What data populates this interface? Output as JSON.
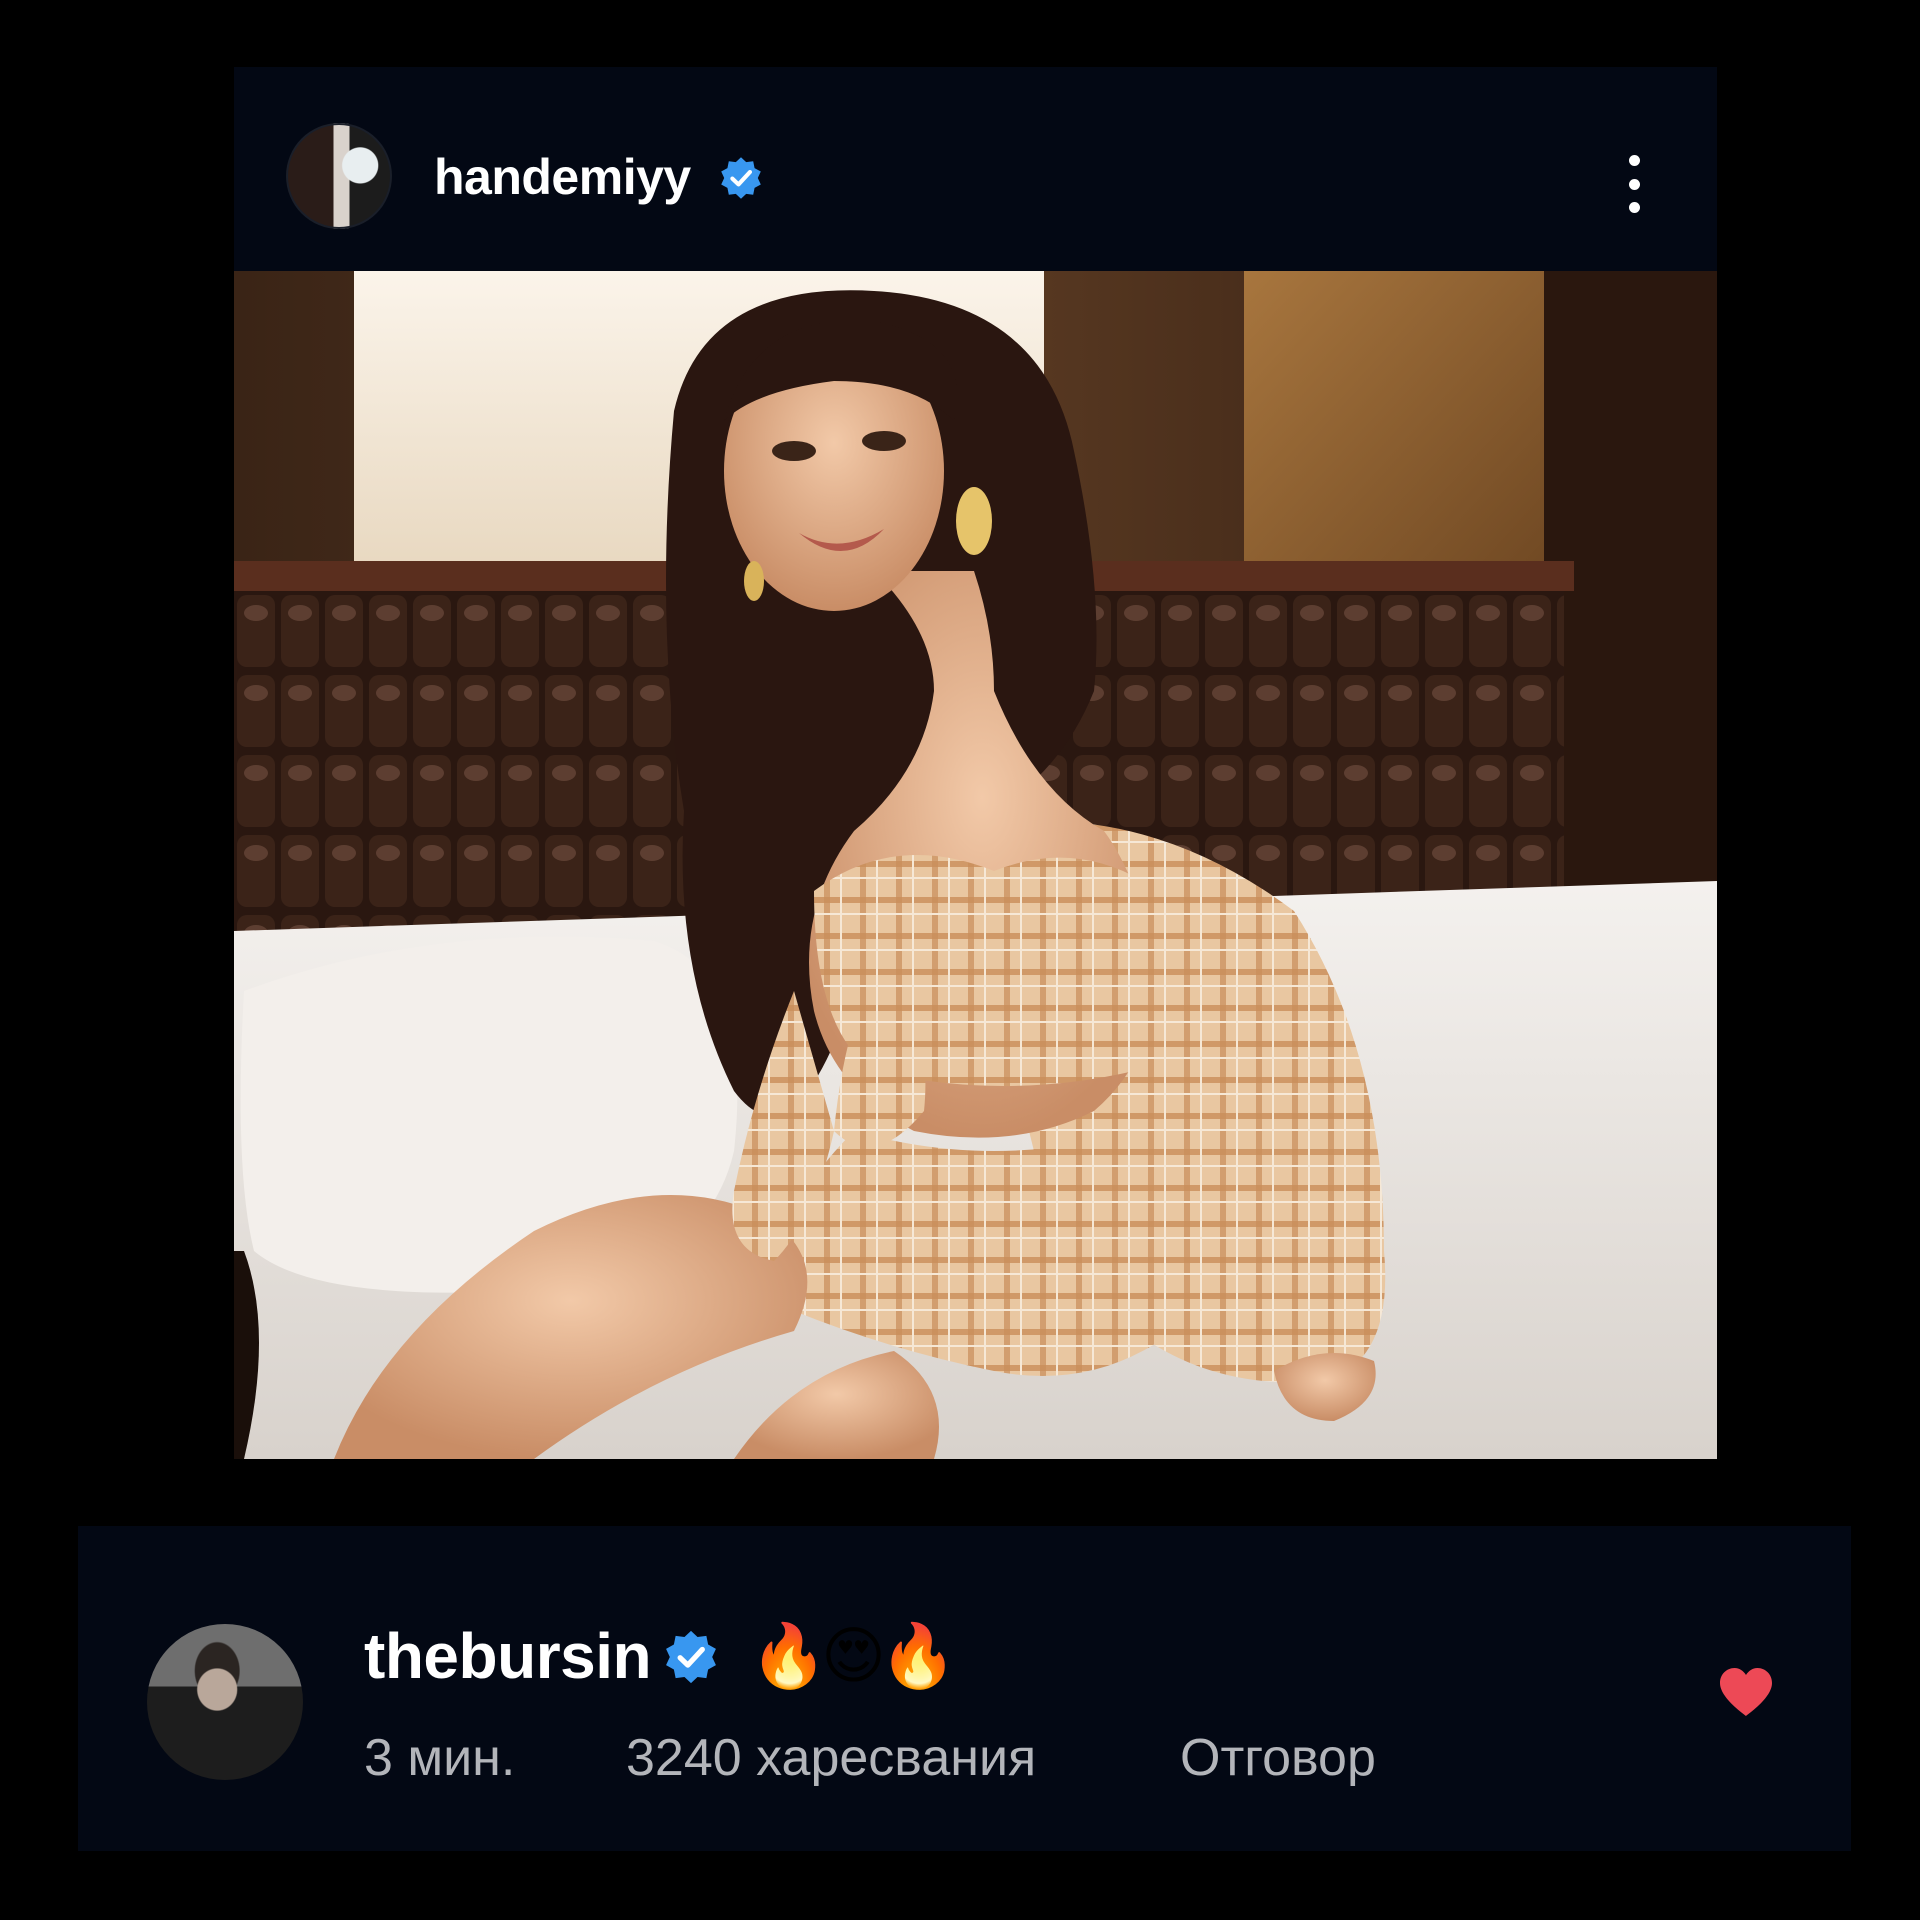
{
  "post": {
    "username": "handemiyy",
    "verified": true,
    "verified_icon": "verified-badge-icon",
    "more_icon": "more-vertical-icon",
    "avatar_icon": "profile-avatar",
    "photo_description_icon": "post-photo"
  },
  "comment": {
    "username": "thebursin",
    "verified": true,
    "text": "🔥😍🔥",
    "time": "3 мин.",
    "likes": "3240 харесвания",
    "reply_label": "Отговор",
    "like_icon": "heart-icon"
  },
  "colors": {
    "background": "#000000",
    "card": "#030814",
    "verified": "#3897f0",
    "like": "#ed4956",
    "meta_text": "#b3b5ba",
    "username": "#ffffff"
  }
}
